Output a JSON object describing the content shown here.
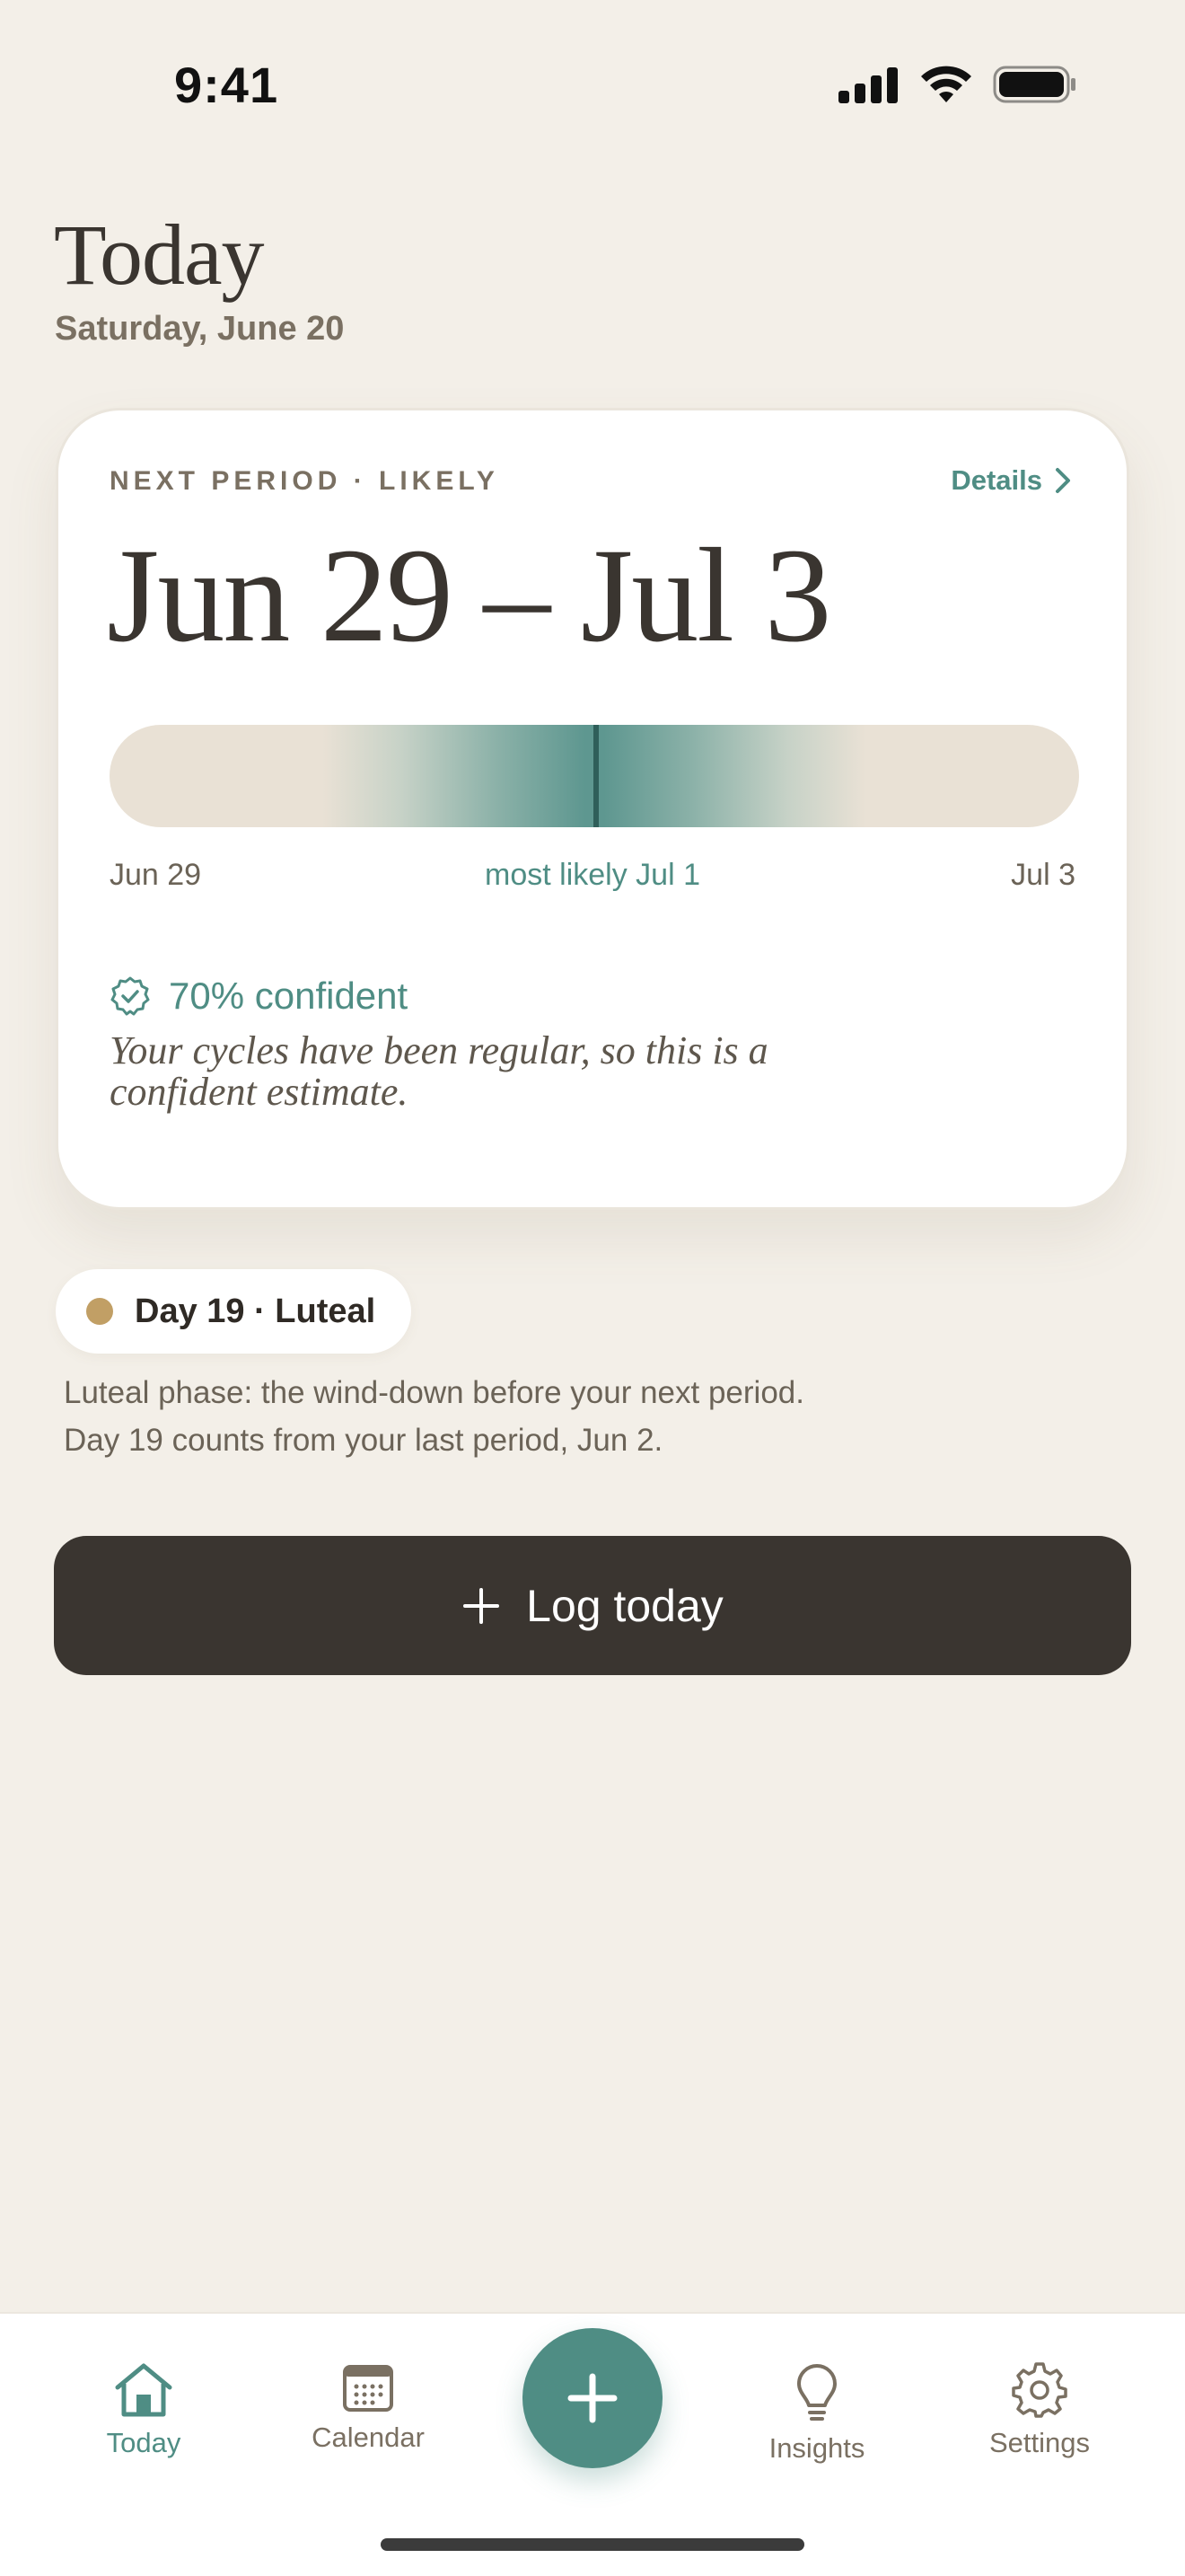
{
  "status_bar": {
    "time": "9:41"
  },
  "header": {
    "title": "Today",
    "date": "Saturday, June 20"
  },
  "prediction_card": {
    "eyebrow": "NEXT PERIOD · LIKELY",
    "details_label": "Details",
    "range_text": "Jun 29 – Jul 3",
    "range_start_label": "Jun 29",
    "range_likely_label": "most likely Jul 1",
    "range_end_label": "Jul 3",
    "confidence_label": "70% confident",
    "confidence_note": "Your cycles have been regular, so this is a confident estimate."
  },
  "phase": {
    "pill_label": "Day 19 · Luteal",
    "dot_color": "#C19F65",
    "description_line1": "Luteal phase: the wind-down before your next period.",
    "description_line2": "Day 19 counts from your last period, Jun 2."
  },
  "log_button": {
    "label": "Log today",
    "icon": "plus-icon"
  },
  "tab_bar": {
    "tabs": [
      {
        "label": "Today",
        "icon": "home-icon",
        "active": true
      },
      {
        "label": "Calendar",
        "icon": "calendar-icon",
        "active": false
      },
      {
        "label": "Insights",
        "icon": "lightbulb-icon",
        "active": false
      },
      {
        "label": "Settings",
        "icon": "gear-icon",
        "active": false
      }
    ],
    "fab_icon": "plus-icon"
  },
  "colors": {
    "background": "#F3EFE8",
    "accent": "#4F8D84",
    "dark_button": "#3A3530"
  }
}
